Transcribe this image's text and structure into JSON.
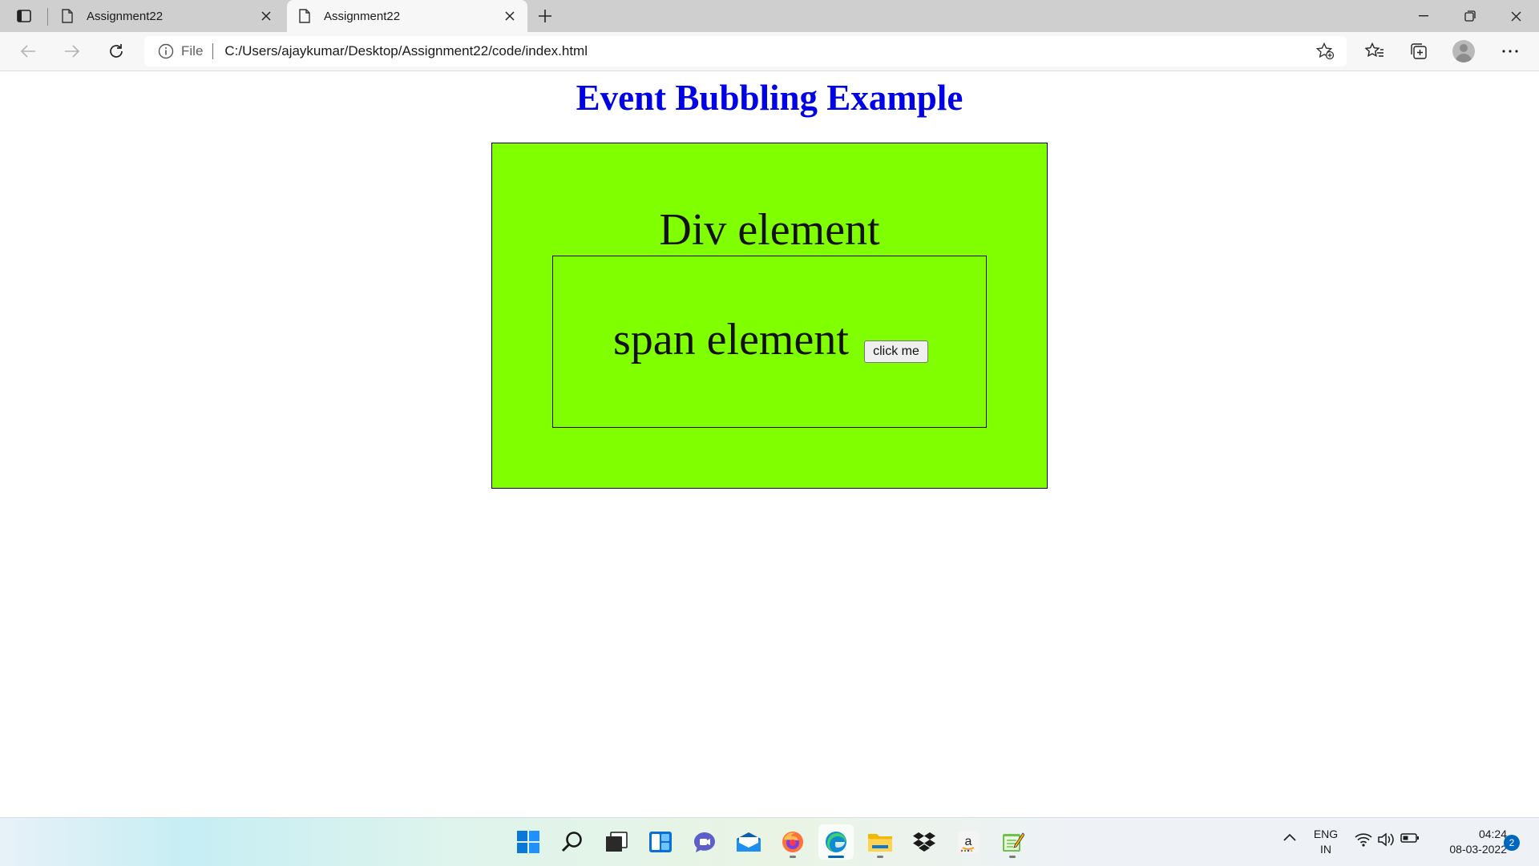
{
  "browser": {
    "tabs": [
      {
        "title": "Assignment22",
        "active": false
      },
      {
        "title": "Assignment22",
        "active": true
      }
    ],
    "address": {
      "scheme_label": "File",
      "url": "C:/Users/ajaykumar/Desktop/Assignment22/code/index.html"
    }
  },
  "page": {
    "title": "Event Bubbling Example",
    "title_color": "#0000e6",
    "box_color": "#80ff00",
    "div_label": "Div element",
    "span_label": "span element",
    "button_label": "click me"
  },
  "taskbar": {
    "apps": [
      "start-icon",
      "search-icon",
      "task-view-icon",
      "widgets-icon",
      "teams-chat-icon",
      "mail-icon",
      "firefox-icon",
      "edge-icon",
      "file-explorer-icon",
      "dropbox-icon",
      "amazon-icon",
      "notepad-icon"
    ],
    "language_line1": "ENG",
    "language_line2": "IN",
    "time": "04:24",
    "date": "08-03-2022",
    "notification_count": "2"
  }
}
